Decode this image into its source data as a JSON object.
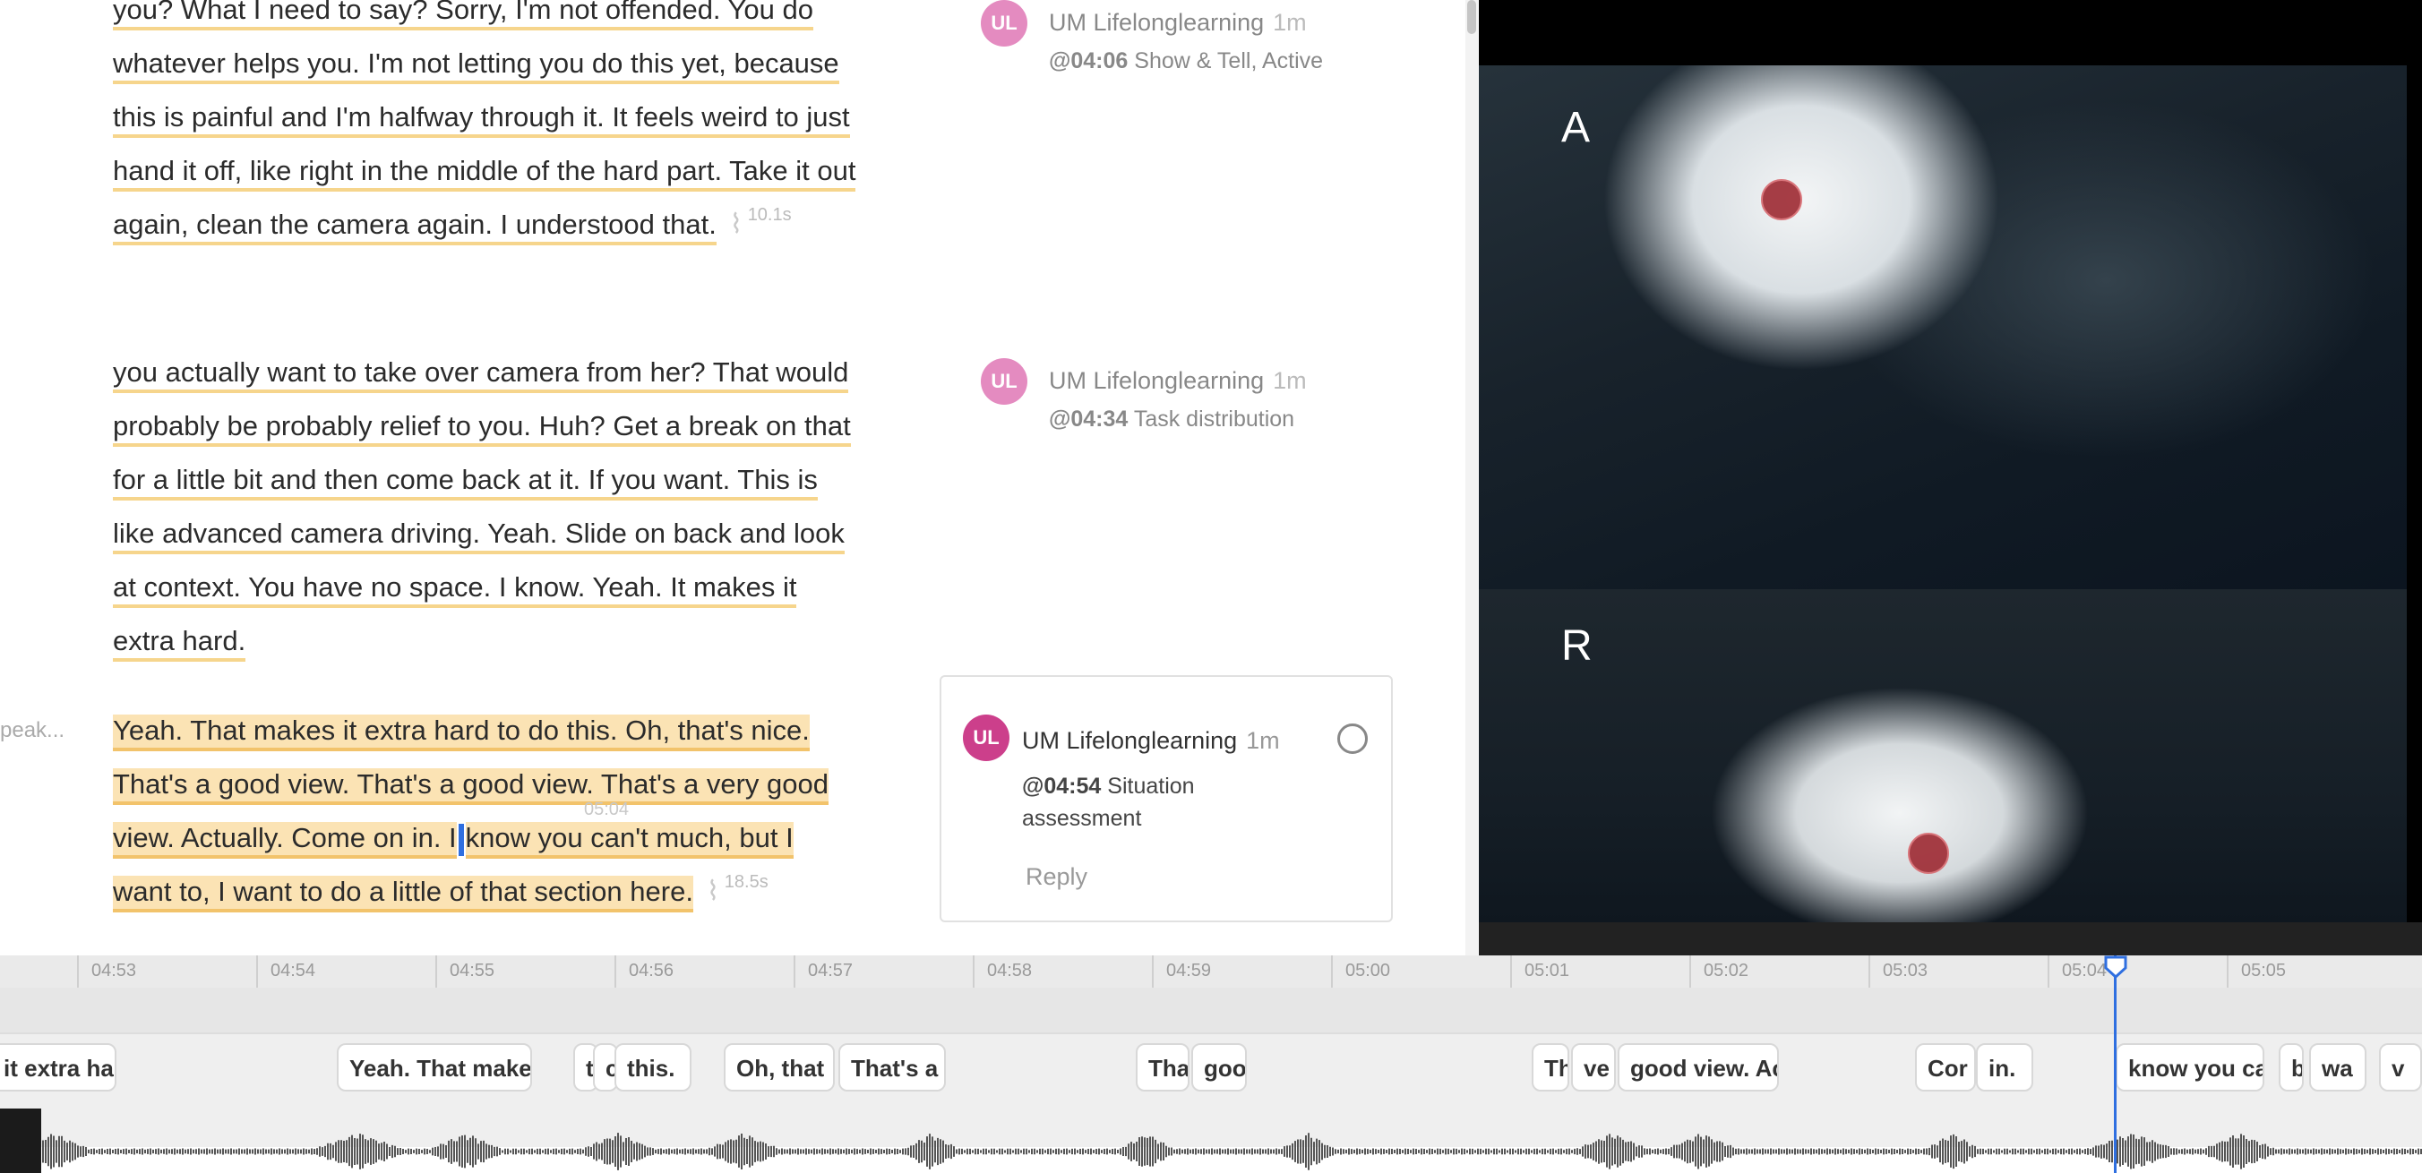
{
  "transcript": {
    "paragraphs": [
      {
        "text": "you? What I need to say? Sorry, I'm not offended. You do whatever helps you. I'm not letting you do this yet, because this is painful and I'm halfway through it. It feels weird to just hand it off, like right in the middle of the hard part. Take it out again, clean the camera again. I understood that.",
        "pause": "10.1s"
      },
      {
        "text": "you actually want to take over camera from her? That would probably be probably relief to you. Huh? Get a break on that for a little bit and then come back at it. If you want. This is like advanced camera driving. Yeah. Slide on back and look at context. You have no space. I know. Yeah. It makes it extra hard.",
        "pause": ""
      },
      {
        "text_before": "Yeah. That makes it extra hard to do this. Oh, that's nice. That's a good view. That's a good view. That's a very good view. Actually. Come on in. I",
        "text_after": "know you can't much, but I want to, I want to do a little of that section here.",
        "pause": "18.5s",
        "cursor_time": "05:04"
      }
    ],
    "speaker_label": "peak..."
  },
  "comments": [
    {
      "avatar": "UL",
      "author": "UM Lifelonglearning",
      "ago": "1m",
      "timestamp": "@04:06",
      "tags": "Show & Tell, Active"
    },
    {
      "avatar": "UL",
      "author": "UM Lifelonglearning",
      "ago": "1m",
      "timestamp": "@04:34",
      "tags": "Task distribution"
    }
  ],
  "active_comment": {
    "avatar": "UL",
    "author": "UM Lifelonglearning",
    "ago": "1m",
    "timestamp": "@04:54",
    "tags": "Situation assessment",
    "reply_label": "Reply"
  },
  "video": {
    "panel_a_label": "A",
    "panel_r_label": "R"
  },
  "timeline": {
    "ticks": [
      "04:53",
      "04:54",
      "04:55",
      "04:56",
      "04:57",
      "04:58",
      "04:59",
      "05:00",
      "05:01",
      "05:02",
      "05:03",
      "05:04",
      "05:05"
    ],
    "words": [
      "it extra ha",
      "Yeah. That make",
      "t",
      "c",
      "this.",
      "Oh, that",
      "That's a",
      "Tha",
      "goo",
      "Th",
      "ve",
      "good view. Ac",
      "Cor",
      "in.",
      "know you ca",
      "b",
      "wa",
      "v"
    ]
  },
  "colors": {
    "accent": "#2f6fe0",
    "highlight": "#f6d58c",
    "selected_highlight": "#fbe3b4",
    "avatar": "#e48bc0",
    "avatar_active": "#cc3f8b"
  }
}
